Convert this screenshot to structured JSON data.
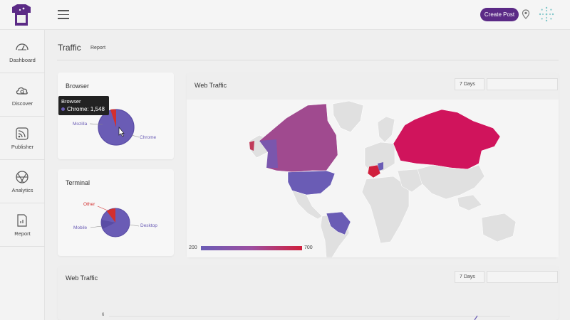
{
  "header": {
    "create_post_label": "Create Post"
  },
  "sidebar": {
    "items": [
      {
        "label": "Dashboard",
        "icon": "gauge-icon"
      },
      {
        "label": "Discover",
        "icon": "cloud-search-icon"
      },
      {
        "label": "Publisher",
        "icon": "rss-icon"
      },
      {
        "label": "Analytics",
        "icon": "aperture-icon"
      },
      {
        "label": "Report",
        "icon": "document-chart-icon"
      }
    ]
  },
  "page": {
    "title": "Traffic",
    "subtitle": "Report"
  },
  "browser_card": {
    "title": "Browser",
    "tooltip_title": "Browser",
    "tooltip_value": "Chrome: 1,548",
    "labels": {
      "mozilla": "Mozilla",
      "chrome": "Chrome"
    }
  },
  "terminal_card": {
    "title": "Terminal",
    "labels": {
      "other": "Other",
      "mobile": "Mobile",
      "desktop": "Desktop"
    }
  },
  "web_traffic_card": {
    "title": "Web Traffic",
    "range": "7 Days",
    "legend_min": "200",
    "legend_max": "700"
  },
  "web_traffic_card_2": {
    "title": "Web Traffic",
    "range": "7 Days",
    "y_tick": "6"
  },
  "colors": {
    "accent": "#5b2a86",
    "chrome": "#6a5cb5",
    "mozilla": "#d32f2f",
    "high": "#d0145c",
    "mid": "#a04a8f"
  }
}
